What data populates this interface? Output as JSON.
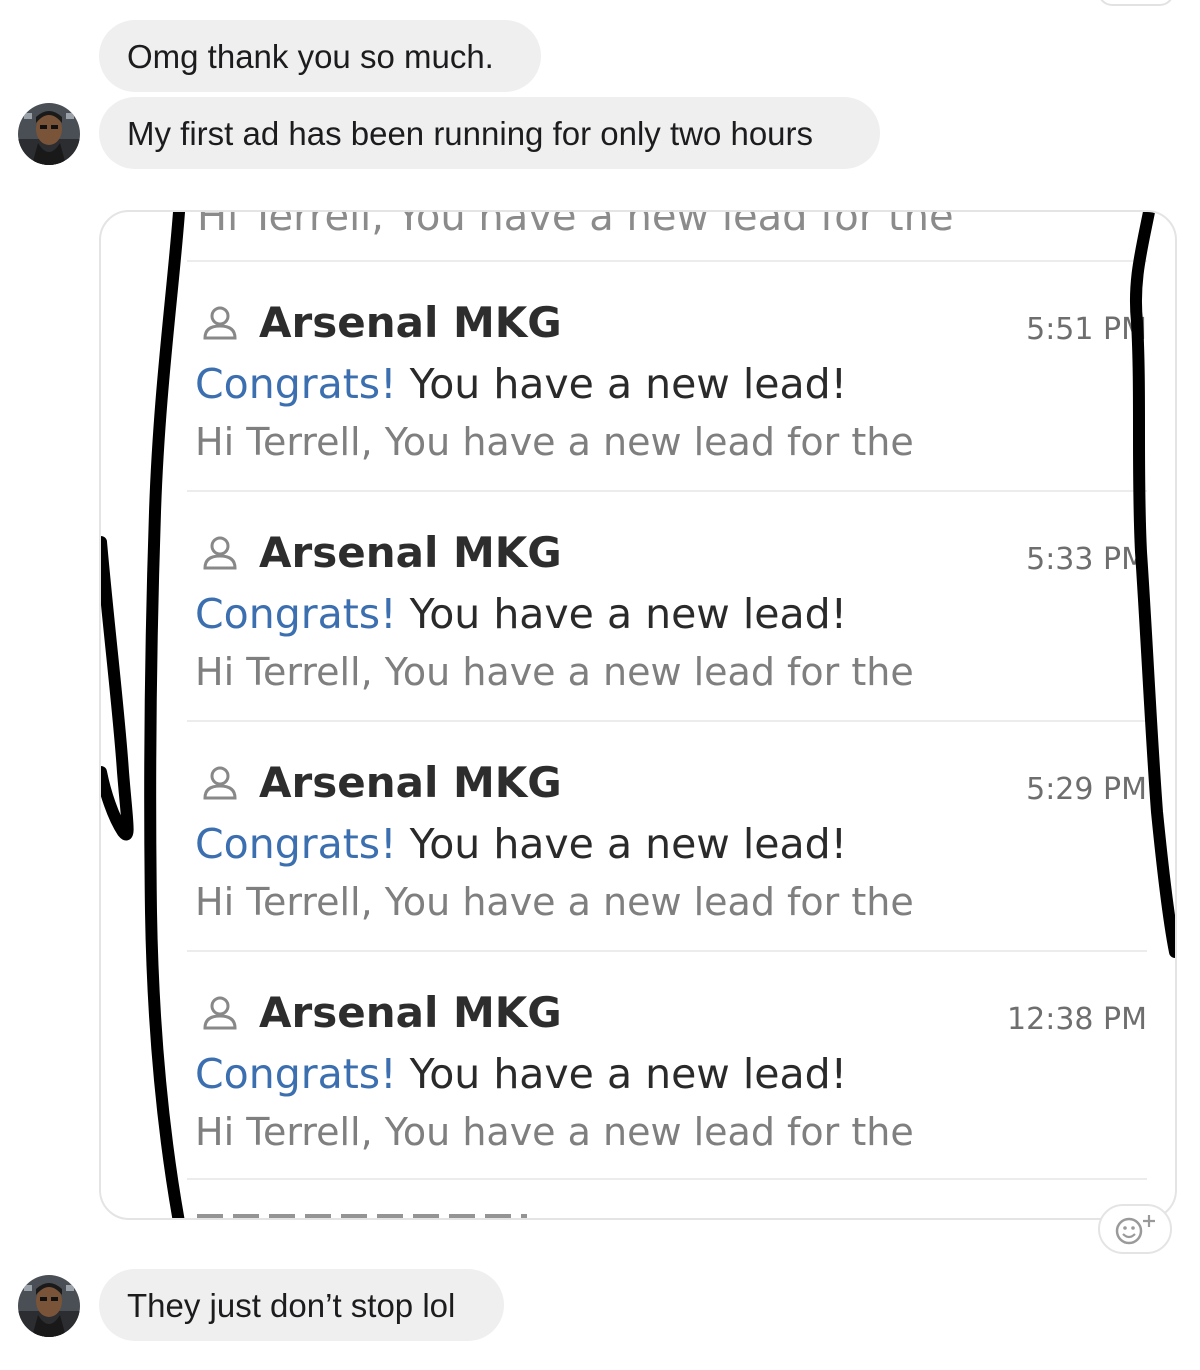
{
  "messages": [
    {
      "text": "Omg thank you so much."
    },
    {
      "text": "My first ad has been running for only two hours"
    },
    {
      "text": "They just don’t stop lol"
    }
  ],
  "screenshot": {
    "cut_top_text": "Hi Terrell, You have a new lead for the",
    "emails": [
      {
        "sender": "Arsenal MKG",
        "time": "5:51 PM",
        "subject_accent": "Congrats!",
        "subject_rest": " You have a new lead!",
        "preview": "Hi Terrell, You have a new lead for the"
      },
      {
        "sender": "Arsenal MKG",
        "time": "5:33 PM",
        "subject_accent": "Congrats!",
        "subject_rest": " You have a new lead!",
        "preview": "Hi Terrell, You have a new lead for the"
      },
      {
        "sender": "Arsenal MKG",
        "time": "5:29 PM",
        "subject_accent": "Congrats!",
        "subject_rest": " You have a new lead!",
        "preview": "Hi Terrell, You have a new lead for the"
      },
      {
        "sender": "Arsenal MKG",
        "time": "12:38 PM",
        "subject_accent": "Congrats!",
        "subject_rest": " You have a new lead!",
        "preview": "Hi Terrell, You have a new lead for the"
      }
    ]
  },
  "colors": {
    "bubble_bg": "#efefef",
    "accent_blue": "#3c6fb0",
    "marker": "#000000"
  },
  "icons": {
    "avatar": "avatar",
    "sender": "person-icon",
    "reaction": "add-reaction-icon"
  }
}
